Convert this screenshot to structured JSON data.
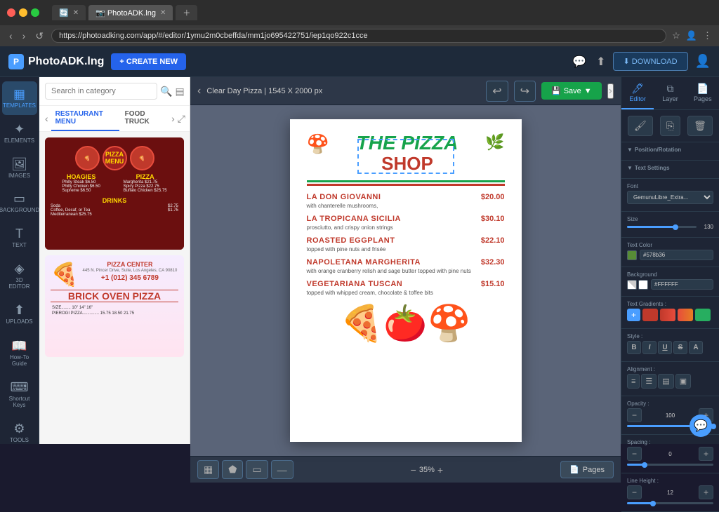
{
  "browser": {
    "tabs": [
      {
        "label": "🔄",
        "active": false
      },
      {
        "label": "PhotoADK.lng",
        "active": true
      },
      {
        "label": "＋",
        "active": false
      }
    ],
    "address": "https://photoadking.com/app/#/editor/1ymu2m0cbeffda/mm1jo695422751/iep1qo922c1cce",
    "nav_back": "‹",
    "nav_forward": "›",
    "refresh": "↺"
  },
  "header": {
    "logo_text": "PhotoADK.lng",
    "create_label": "+ CREATE NEW",
    "download_label": "⬇ DOWNLOAD"
  },
  "sidebar": {
    "items": [
      {
        "icon": "▦",
        "label": "TEMPLATES"
      },
      {
        "icon": "✦",
        "label": "ELEMENTS"
      },
      {
        "icon": "🖼",
        "label": "IMAGES"
      },
      {
        "icon": "▭",
        "label": "BACKGROUND"
      },
      {
        "icon": "T",
        "label": "TEXT"
      },
      {
        "icon": "◈",
        "label": "3D EDITOR"
      },
      {
        "icon": "⬆",
        "label": "UPLOADS"
      },
      {
        "icon": "⚙",
        "label": "TOOLS"
      }
    ]
  },
  "template_panel": {
    "search_placeholder": "Search in category",
    "tabs": [
      "RESTAURANT MENU",
      "FOOD TRUCK"
    ],
    "thumb1": {
      "title": "PIZZA",
      "subtitle": "MENU",
      "sections": [
        "HOAGIES",
        "PIZZA"
      ],
      "drinks_label": "DRINKS"
    },
    "thumb2": {
      "title": "PIZZA CENTER",
      "subtitle": "BRICK OVEN PIZZA",
      "address": "445 N. Pincer Drive, Suite, Los Angeles, CA 90810",
      "phone": "+1 (012) 345 6789",
      "sizes": "SIZE........  10\"  14\"  16\"",
      "item": "PIEROGI PIZZA..............  15.75  18.50  21.75"
    }
  },
  "canvas": {
    "title": "Clear Day Pizza | 1545 X 2000 px",
    "save_label": "Save",
    "zoom_level": "35%",
    "pages_label": "Pages"
  },
  "document": {
    "title_main": "THE PIZZA",
    "title_sub": "SHOP",
    "items": [
      {
        "name": "LA DON GIOVANNI",
        "price": "$20.00",
        "desc": "with chanterelle mushrooms,"
      },
      {
        "name": "LA TROPICANA SICILIA",
        "price": "$30.10",
        "desc": "prosciutto, and crispy onion strings"
      },
      {
        "name": "ROASTED EGGPLANT",
        "price": "$22.10",
        "desc": "topped with pine nuts and frisée"
      },
      {
        "name": "NAPOLETANA MARGHERITA",
        "price": "$32.30",
        "desc": "with orange cranberry relish and sage butter topped with pine nuts"
      },
      {
        "name": "VEGETARIANA TUSCAN",
        "price": "$15.10",
        "desc": "topped with whipped cream, chocolate & toffee bits"
      }
    ]
  },
  "right_panel": {
    "tabs": [
      "Editor",
      "Layer",
      "Pages"
    ],
    "font_name": "GemunuLibre_Extra...",
    "size_value": "130",
    "text_color_hex": "#578b36",
    "bg_color_hex": "#FFFFFF",
    "opacity_value": "100",
    "spacing_value": "0",
    "line_height_value": "12",
    "gradient_colors": [
      "#c0392b",
      "#e74c3c",
      "#e67e22",
      "#27ae60"
    ],
    "style_buttons": [
      "B",
      "I",
      "U",
      "S",
      "A"
    ],
    "align_buttons": [
      "≡",
      "☰",
      "▤",
      "▣"
    ],
    "sections": {
      "position_rotation": "Position/Rotation",
      "text_settings": "Text Settings",
      "font_label": "Font",
      "size_label": "Size",
      "text_color_label": "Text Color",
      "background_label": "Background",
      "text_gradients_label": "Text Gradients :",
      "style_label": "Style :",
      "alignment_label": "Alignment :",
      "opacity_label": "Opacity :",
      "spacing_label": "Spacing :",
      "line_height_label": "Line Height :"
    }
  }
}
